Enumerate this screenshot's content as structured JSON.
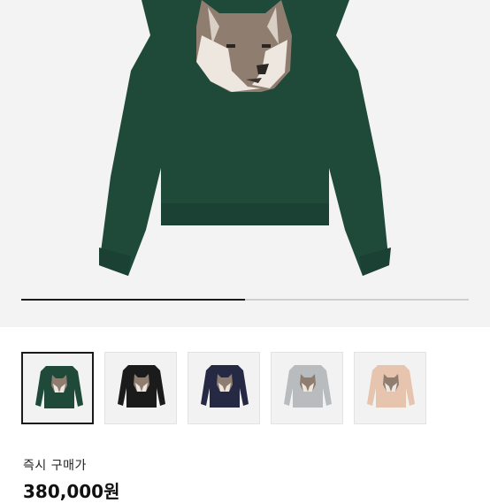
{
  "product": {
    "image_alt": "sweater",
    "gallery_progress": 0.5
  },
  "thumbnails": [
    {
      "color_name": "green",
      "color": "#1f4a3a",
      "selected": true
    },
    {
      "color_name": "black",
      "color": "#1b1b1b",
      "selected": false
    },
    {
      "color_name": "navy",
      "color": "#262944",
      "selected": false
    },
    {
      "color_name": "grey",
      "color": "#b9bcbe",
      "selected": false
    },
    {
      "color_name": "beige",
      "color": "#e6c4ad",
      "selected": false
    }
  ],
  "purchase": {
    "instant_buy_label": "즉시 구매가",
    "price": "380,000원"
  },
  "colors": {
    "hero_background": "#f3f3f3",
    "sweater_green": "#1f4a3a"
  }
}
